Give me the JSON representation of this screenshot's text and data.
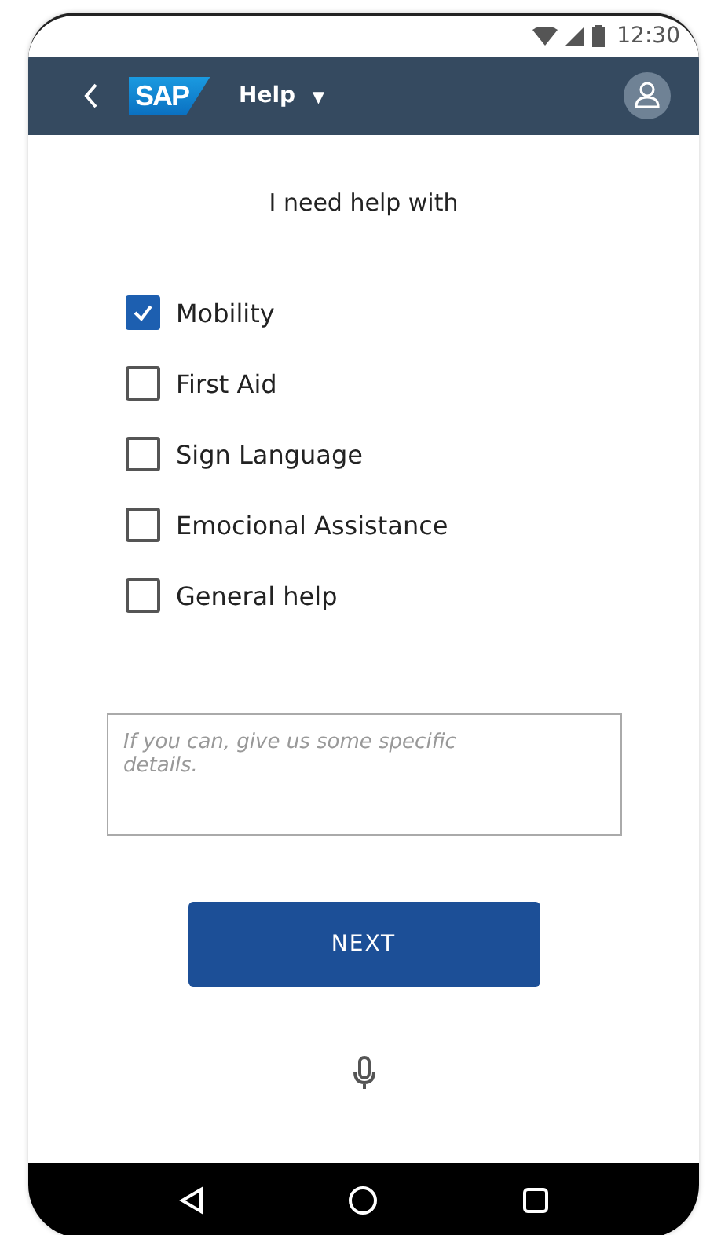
{
  "status_bar": {
    "time": "12:30"
  },
  "header": {
    "logo": "SAP",
    "title": "Help",
    "dropdown_icon": "▼"
  },
  "heading": "I need help with",
  "options": [
    {
      "label": "Mobility",
      "checked": true
    },
    {
      "label": "First Aid",
      "checked": false
    },
    {
      "label": "Sign Language",
      "checked": false
    },
    {
      "label": "Emocional Assistance",
      "checked": false
    },
    {
      "label": "General help",
      "checked": false
    }
  ],
  "details": {
    "placeholder": "If you can, give us some specific details."
  },
  "next_button": "NEXT"
}
